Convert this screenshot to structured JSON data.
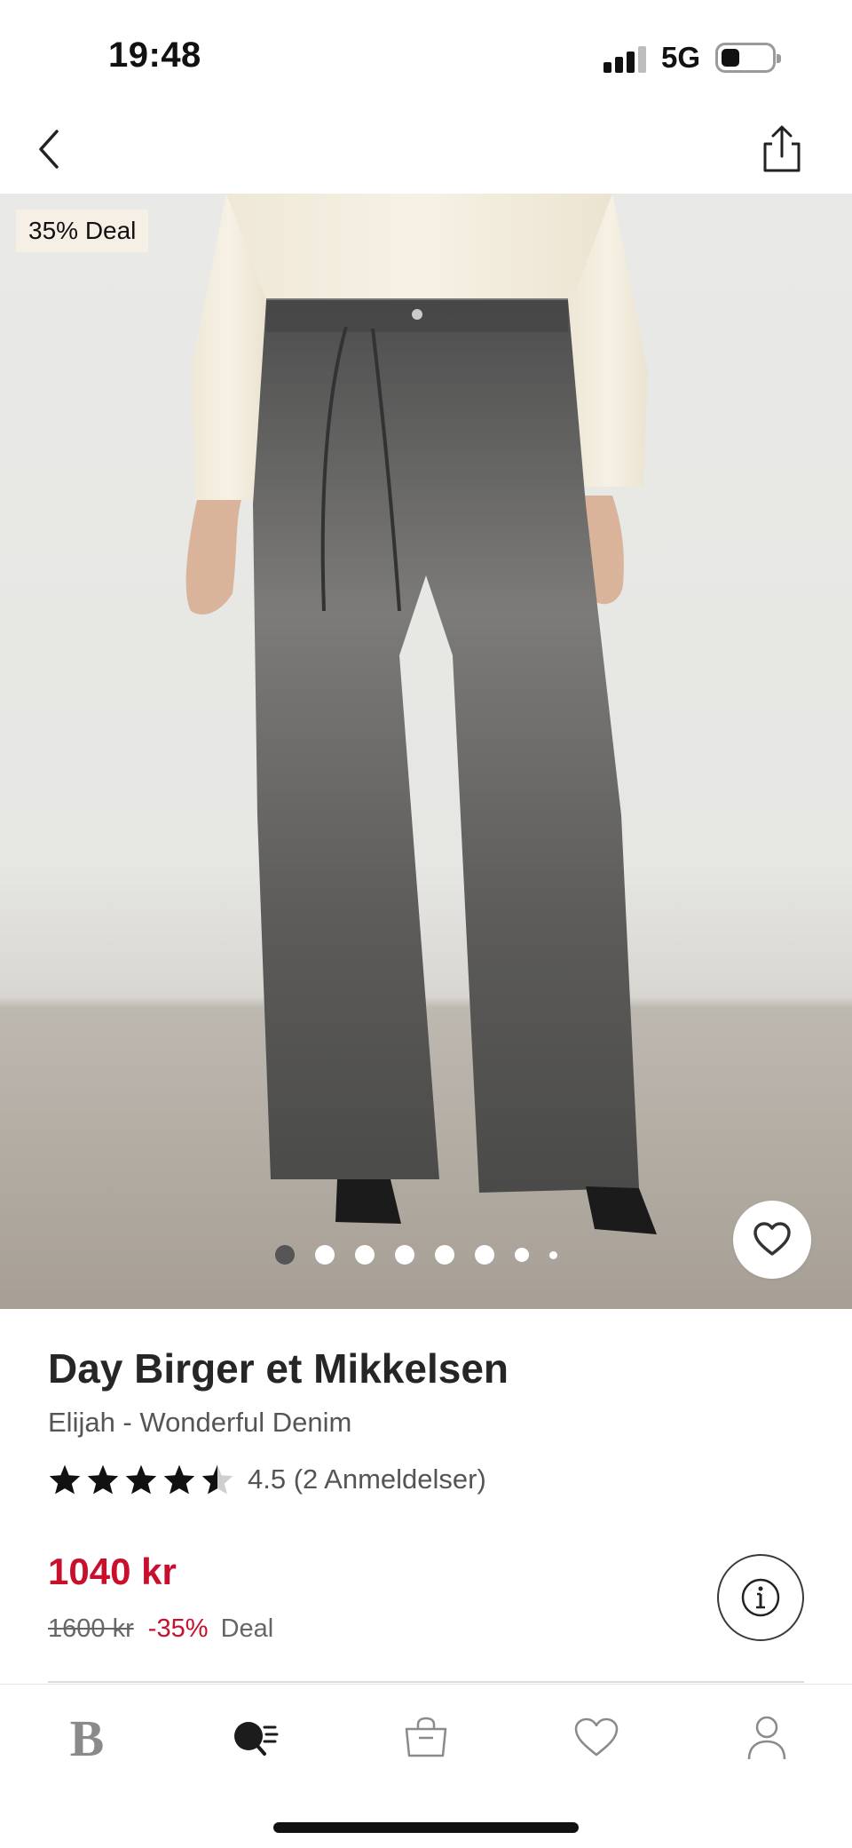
{
  "status_bar": {
    "time": "19:48",
    "network": "5G"
  },
  "top_nav": {
    "back_icon": "chevron-left-icon",
    "share_icon": "share-icon"
  },
  "hero": {
    "badge": "35% Deal",
    "carousel": {
      "total_pages": 8,
      "active_index": 0
    },
    "favorite_icon": "heart-outline-icon"
  },
  "product": {
    "brand": "Day Birger et Mikkelsen",
    "name": "Elijah - Wonderful Denim",
    "rating_value": 4.5,
    "rating_text": "4.5 (2 Anmeldelser)",
    "price_current": "1040 kr",
    "price_original": "1600 kr",
    "discount": "-35%",
    "deal_label": "Deal",
    "info_icon": "info-icon"
  },
  "colors": {
    "accent_red": "#c8102e",
    "text_dark": "#262626",
    "text_muted": "#555555"
  },
  "tab_bar": {
    "items": [
      {
        "id": "home",
        "glyph": "B",
        "icon": "brand-logo-icon"
      },
      {
        "id": "discover",
        "icon": "discover-icon"
      },
      {
        "id": "bag",
        "icon": "shopping-bag-icon"
      },
      {
        "id": "favorites",
        "icon": "heart-icon"
      },
      {
        "id": "profile",
        "icon": "person-icon"
      }
    ]
  }
}
